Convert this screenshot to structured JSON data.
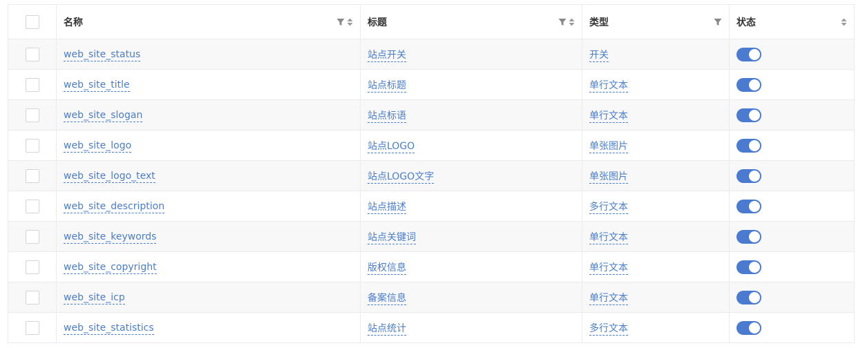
{
  "table": {
    "headers": {
      "name": "名称",
      "title": "标题",
      "type": "类型",
      "status": "状态"
    },
    "rows": [
      {
        "name": "web_site_status",
        "title": "站点开关",
        "type": "开关",
        "enabled": true
      },
      {
        "name": "web_site_title",
        "title": "站点标题",
        "type": "单行文本",
        "enabled": true
      },
      {
        "name": "web_site_slogan",
        "title": "站点标语",
        "type": "单行文本",
        "enabled": true
      },
      {
        "name": "web_site_logo",
        "title": "站点LOGO",
        "type": "单张图片",
        "enabled": true
      },
      {
        "name": "web_site_logo_text",
        "title": "站点LOGO文字",
        "type": "单张图片",
        "enabled": true
      },
      {
        "name": "web_site_description",
        "title": "站点描述",
        "type": "多行文本",
        "enabled": true
      },
      {
        "name": "web_site_keywords",
        "title": "站点关键词",
        "type": "单行文本",
        "enabled": true
      },
      {
        "name": "web_site_copyright",
        "title": "版权信息",
        "type": "单行文本",
        "enabled": true
      },
      {
        "name": "web_site_icp",
        "title": "备案信息",
        "type": "单行文本",
        "enabled": true
      },
      {
        "name": "web_site_statistics",
        "title": "站点统计",
        "type": "多行文本",
        "enabled": true
      }
    ]
  },
  "colors": {
    "link": "#4a7dc8",
    "switch_on": "#4b7bd0",
    "row_stripe": "#f8f8f8",
    "border": "#ebebeb"
  }
}
